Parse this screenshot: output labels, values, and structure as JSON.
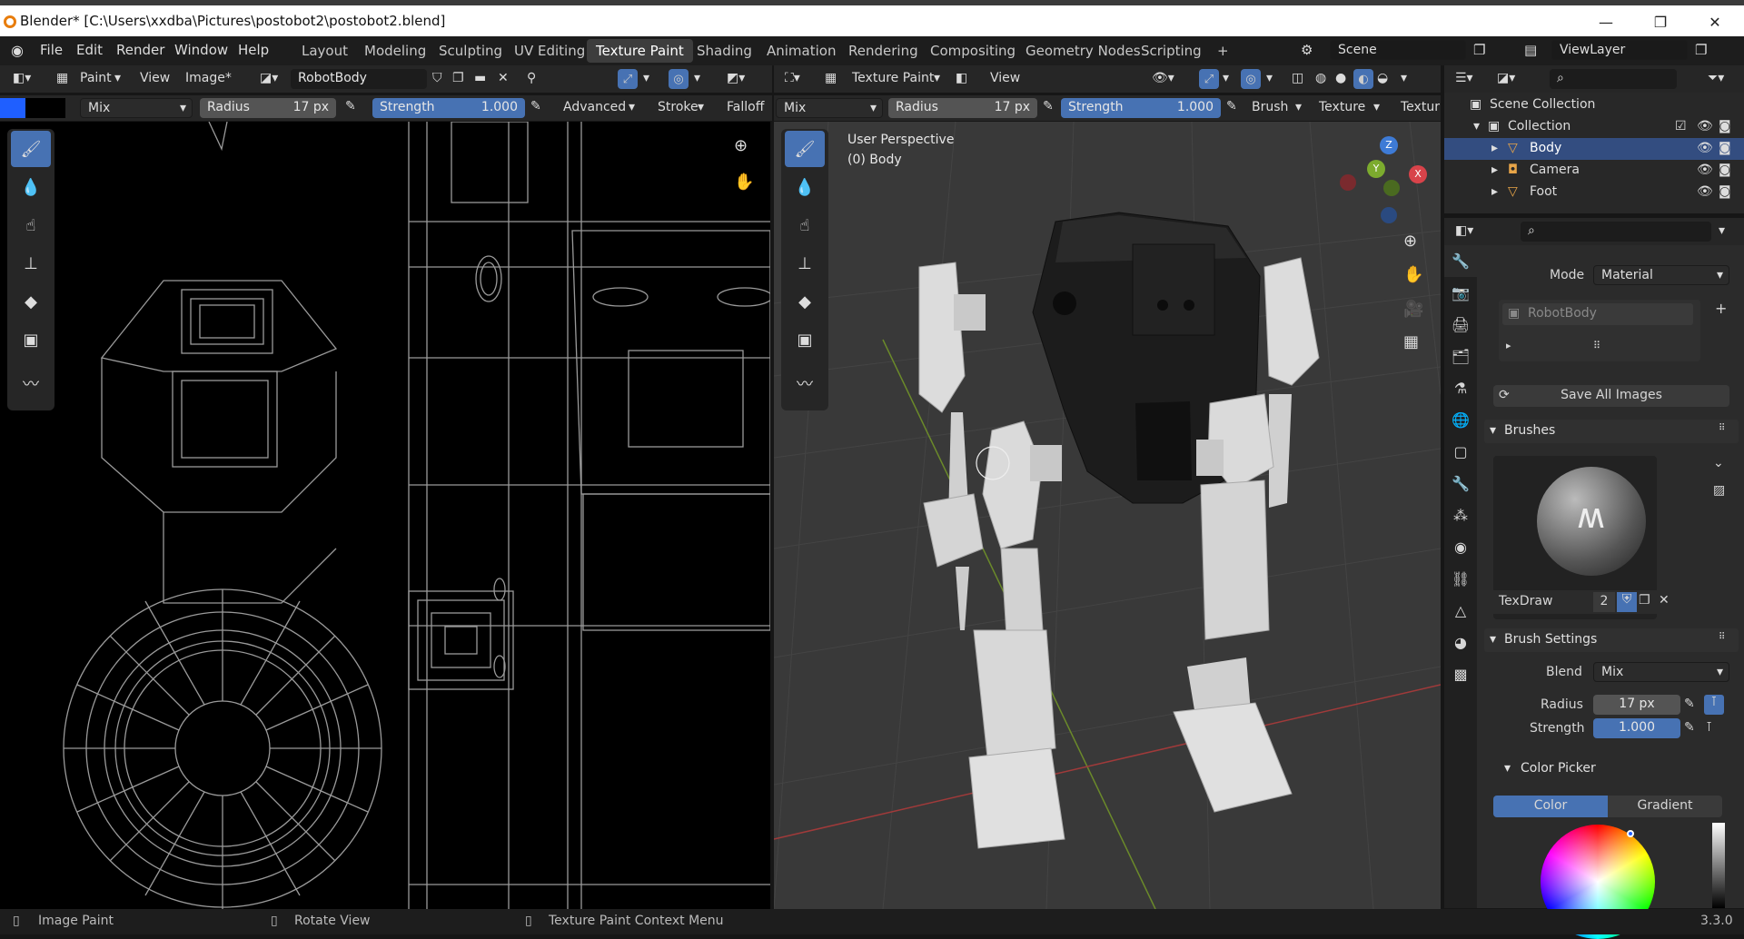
{
  "title": "Blender* [C:\\Users\\xxdba\\Pictures\\postobot2\\postobot2.blend]",
  "window_buttons": {
    "minimize": "—",
    "maximize": "❐",
    "close": "✕"
  },
  "menu": [
    "File",
    "Edit",
    "Render",
    "Window",
    "Help"
  ],
  "workspaces": [
    "Layout",
    "Modeling",
    "Sculpting",
    "UV Editing",
    "Texture Paint",
    "Shading",
    "Animation",
    "Rendering",
    "Compositing",
    "Geometry Nodes",
    "Scripting"
  ],
  "add_tab": "+",
  "scene": "Scene",
  "view_layer": "ViewLayer",
  "image_editor": {
    "mode": "Paint",
    "view": "View",
    "image_menu": "Image*",
    "image_name": "RobotBody",
    "blend": "Mix",
    "radius_label": "Radius",
    "radius": "17 px",
    "strength_label": "Strength",
    "strength": "1.000",
    "advanced": "Advanced",
    "stroke": "Stroke",
    "falloff": "Falloff"
  },
  "viewport": {
    "mode": "Texture Paint",
    "view": "View",
    "blend": "Mix",
    "radius_label": "Radius",
    "radius": "17 px",
    "strength_label": "Strength",
    "strength": "1.000",
    "brush": "Brush",
    "texture": "Texture",
    "texture2": "Textur",
    "perspective": "User Perspective",
    "object": "(0) Body",
    "gizmo": {
      "z": "Z",
      "y": "Y",
      "x": "X"
    }
  },
  "outliner": {
    "root": "Scene Collection",
    "collection": "Collection",
    "items": [
      "Body",
      "Camera",
      "Foot"
    ]
  },
  "properties": {
    "mode_label": "Mode",
    "mode": "Material",
    "slot": "RobotBody",
    "save_all": "Save All Images",
    "brushes_header": "Brushes",
    "brush_name": "TexDraw",
    "brush_users": "2",
    "brush_settings_header": "Brush Settings",
    "blend_label": "Blend",
    "blend": "Mix",
    "radius_label": "Radius",
    "radius": "17 px",
    "strength_label": "Strength",
    "strength": "1.000",
    "color_picker_header": "Color Picker",
    "color_tab": "Color",
    "gradient_tab": "Gradient"
  },
  "status": {
    "left": "Image Paint",
    "middle": "Rotate View",
    "right": "Texture Paint Context Menu",
    "version": "3.3.0"
  },
  "colors": {
    "accent": "#4772b3",
    "brand": "#e87d0d",
    "active_color": "#1f5fff"
  }
}
